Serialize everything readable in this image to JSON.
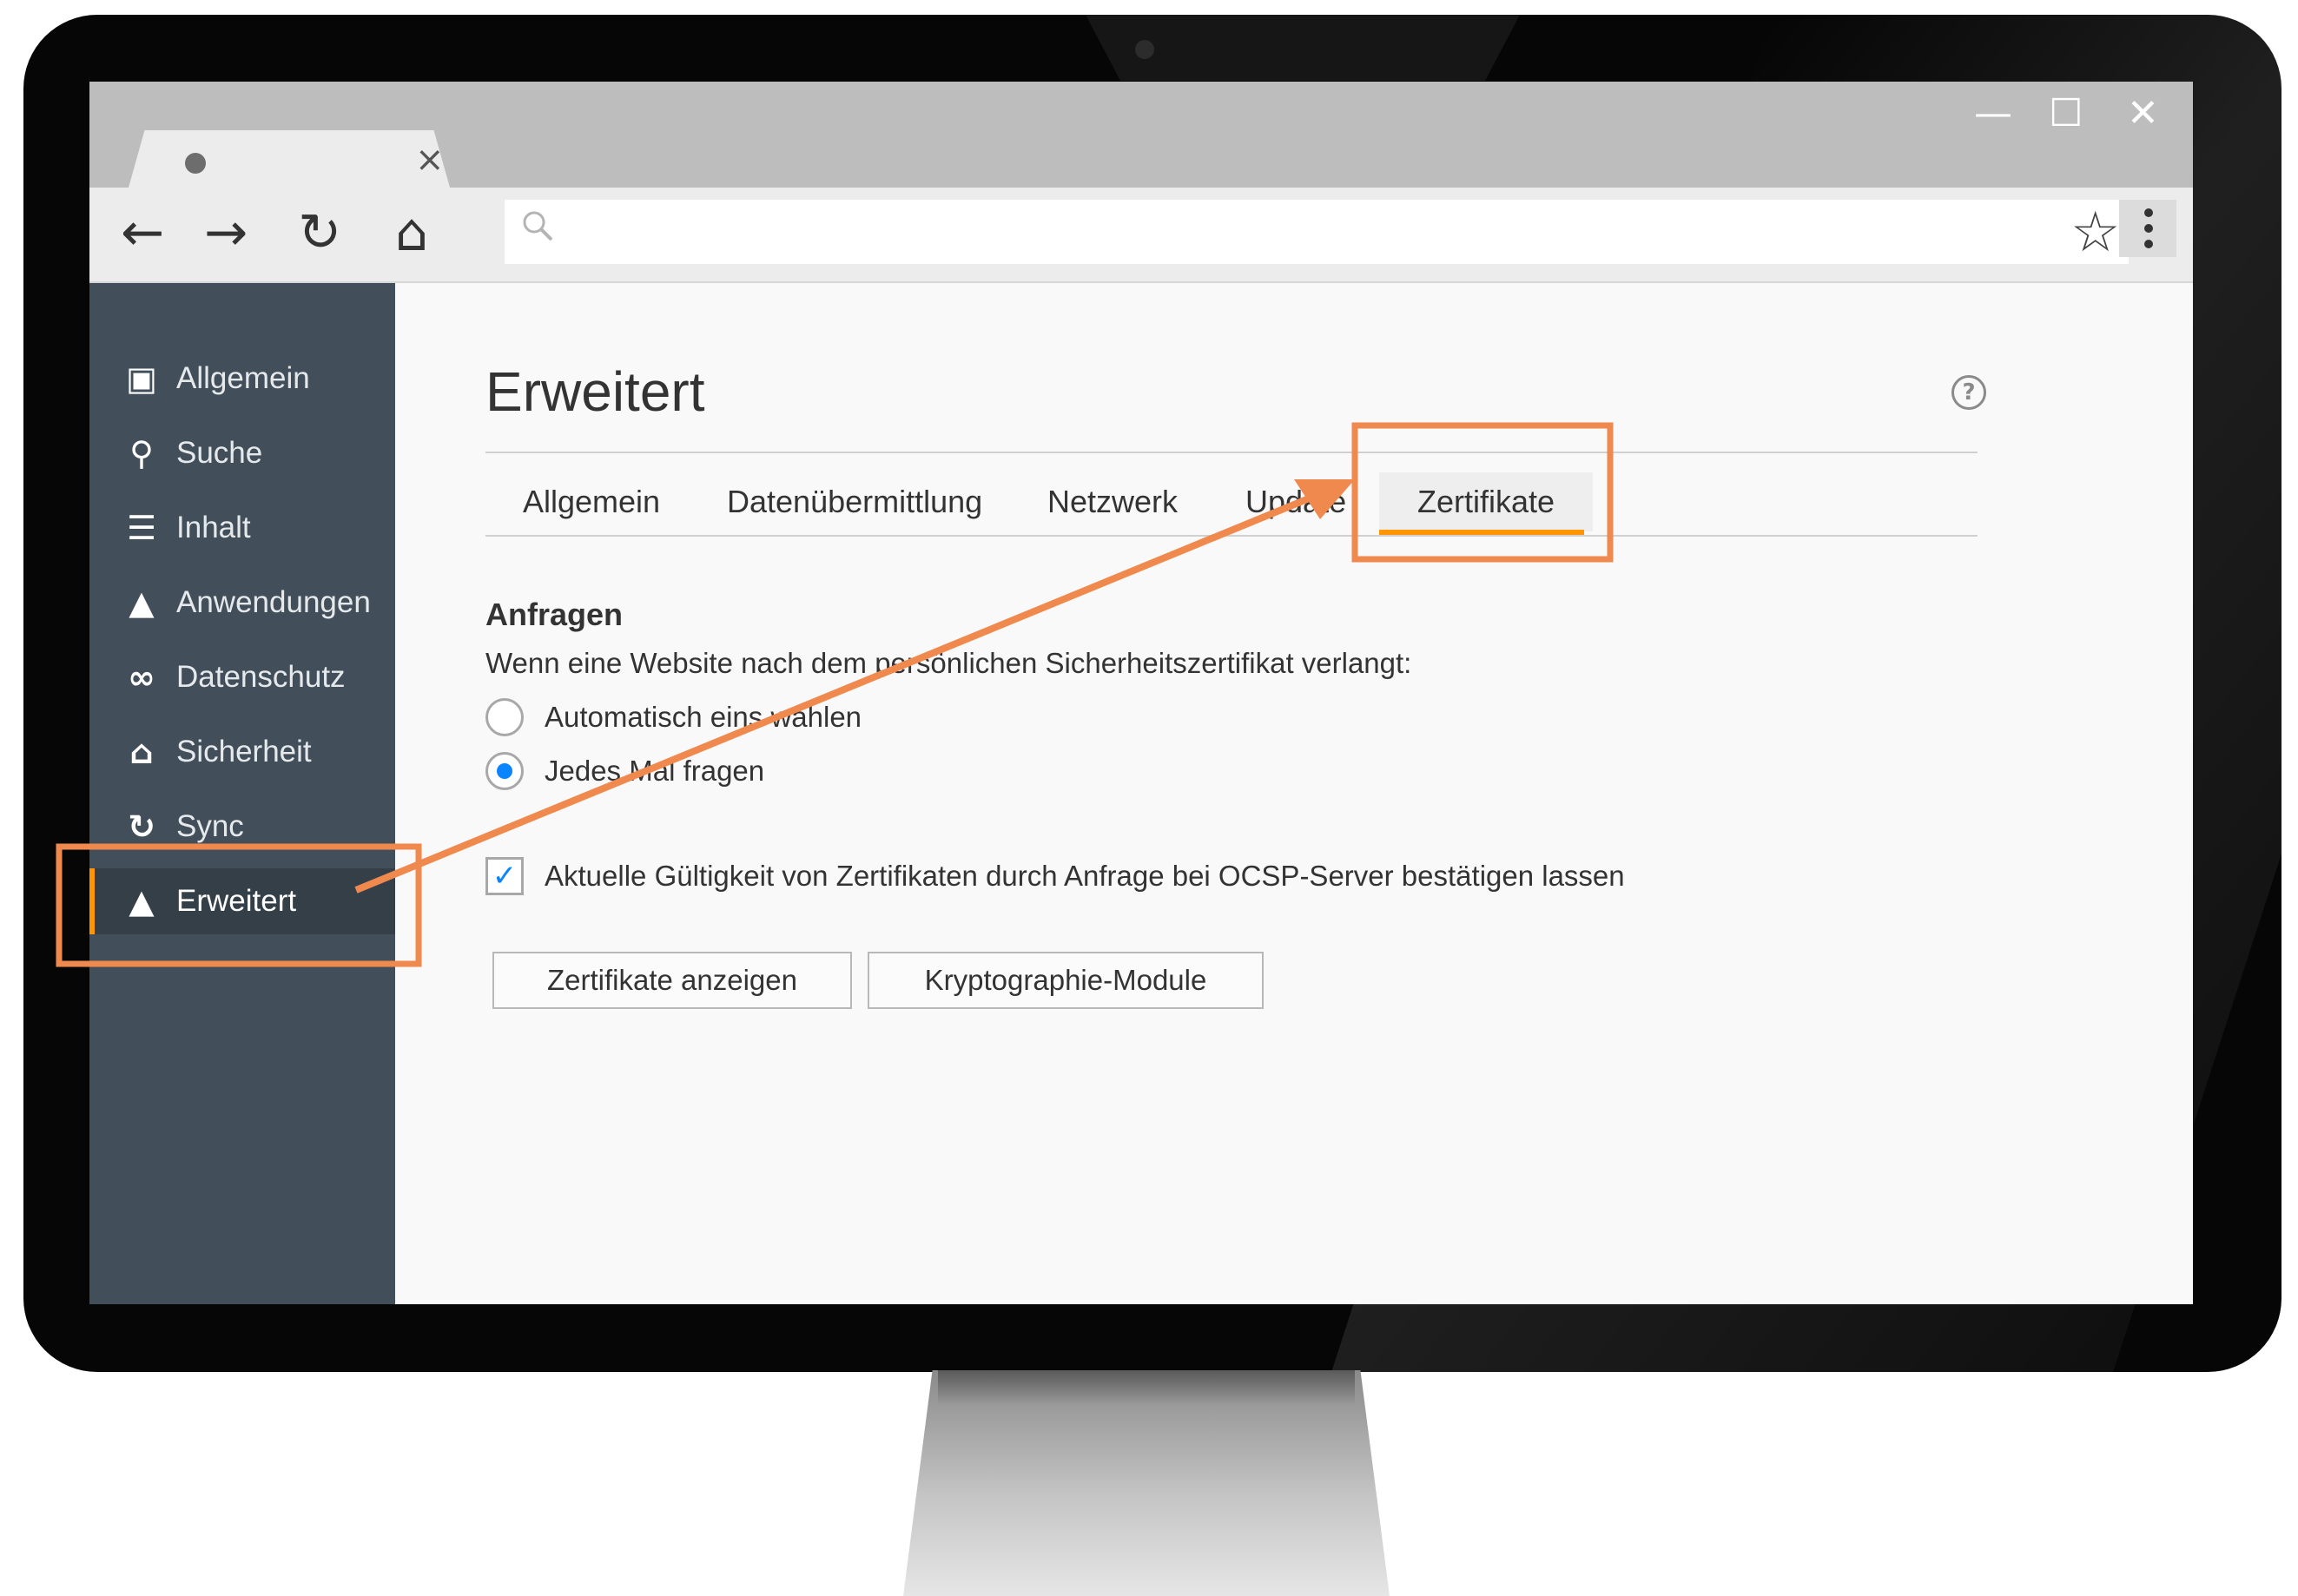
{
  "window": {
    "tab_close": "×",
    "minimize": "—",
    "maximize": "☐",
    "close": "✕"
  },
  "toolbar": {
    "back": "←",
    "forward": "→",
    "reload": "↻",
    "home": "⌂",
    "url_value": "",
    "star": "☆"
  },
  "sidebar": {
    "items": [
      {
        "label": "Allgemein",
        "icon": "general-icon",
        "glyph": "▣"
      },
      {
        "label": "Suche",
        "icon": "search-icon",
        "glyph": "⚲"
      },
      {
        "label": "Inhalt",
        "icon": "document-icon",
        "glyph": "☰"
      },
      {
        "label": "Anwendungen",
        "icon": "rocket-icon",
        "glyph": "▲"
      },
      {
        "label": "Datenschutz",
        "icon": "mask-icon",
        "glyph": "∞"
      },
      {
        "label": "Sicherheit",
        "icon": "lock-icon",
        "glyph": "⌂"
      },
      {
        "label": "Sync",
        "icon": "sync-icon",
        "glyph": "↻"
      },
      {
        "label": "Erweitert",
        "icon": "wizard-hat-icon",
        "glyph": "▲"
      }
    ],
    "active_index": 7
  },
  "main": {
    "title": "Erweitert",
    "help": "?",
    "tabs": [
      "Allgemein",
      "Datenübermittlung",
      "Netzwerk",
      "Update",
      "Zertifikate"
    ],
    "active_tab": "Zertifikate",
    "section_title": "Anfragen",
    "section_desc": "Wenn eine Website nach dem persönlichen Sicherheitszertifikat verlangt:",
    "radio_options": [
      {
        "label": "Automatisch eins wählen",
        "checked": false
      },
      {
        "label": "Jedes Mal fragen",
        "checked": true
      }
    ],
    "checkbox": {
      "label": "Aktuelle Gültigkeit von Zertifikaten durch Anfrage bei OCSP-Server bestätigen lassen",
      "checked": true,
      "mark": "✓"
    },
    "buttons": [
      "Zertifikate anzeigen",
      "Kryptographie-Module"
    ]
  },
  "annotation": {
    "color": "#f0894e"
  }
}
